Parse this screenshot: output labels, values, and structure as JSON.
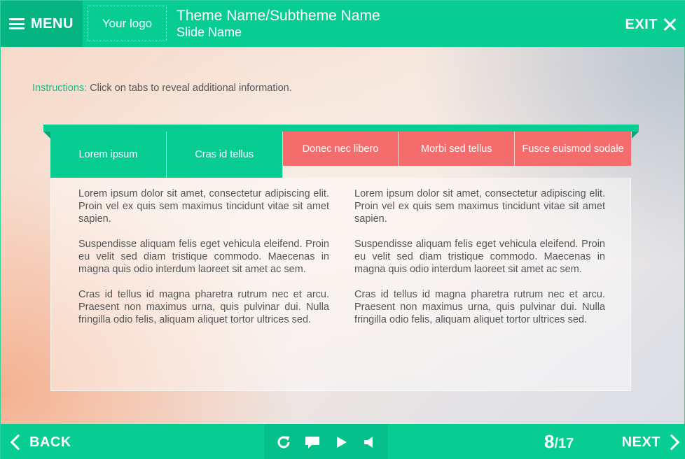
{
  "header": {
    "menu_label": "MENU",
    "logo_text": "Your logo",
    "theme_name": "Theme Name/Subtheme Name",
    "slide_name": "Slide Name",
    "exit_label": "EXIT"
  },
  "instructions": {
    "label": "Instructions:",
    "text": " Click on tabs to reveal additional information."
  },
  "tabs": [
    {
      "label": "Lorem ipsum",
      "state": "active"
    },
    {
      "label": "Cras id tellus",
      "state": "active"
    },
    {
      "label": "Donec nec libero",
      "state": "inactive"
    },
    {
      "label": "Morbi sed tellus",
      "state": "inactive"
    },
    {
      "label": "Fusce euismod sodale",
      "state": "inactive"
    }
  ],
  "content": {
    "left": [
      "Lorem ipsum dolor sit amet, consectetur adipiscing elit. Proin vel ex quis sem maximus tincidunt vitae sit amet sapien.",
      "Suspendisse aliquam felis eget vehicula eleifend. Proin eu velit sed diam tristique commodo. Maecenas in magna quis odio interdum laoreet sit amet ac sem.",
      "Cras id tellus id magna pharetra rutrum nec et arcu. Praesent non maximus urna, quis pulvinar dui. Nulla fringilla odio felis, aliquam aliquet tortor ultrices sed."
    ],
    "right": [
      "Lorem ipsum dolor sit amet, consectetur adipiscing elit. Proin vel ex quis sem maximus tincidunt vitae sit amet sapien.",
      "Suspendisse aliquam felis eget vehicula eleifend. Proin eu velit sed diam tristique commodo. Maecenas in magna quis odio interdum laoreet sit amet ac sem.",
      "Cras id tellus id magna pharetra rutrum nec et arcu. Praesent non maximus urna, quis pulvinar dui. Nulla fringilla odio felis, aliquam aliquet tortor ultrices sed."
    ]
  },
  "footer": {
    "back_label": "BACK",
    "next_label": "NEXT",
    "current_slide": "8",
    "separator": "/",
    "total_slides": "17",
    "controls": [
      "replay-icon",
      "comment-icon",
      "play-icon",
      "volume-icon"
    ]
  },
  "colors": {
    "primary": "#08cd93",
    "primary_dark": "#05b480",
    "tab_inactive": "#f46c6c",
    "text": "#555555",
    "instruction_label": "#1bb889"
  }
}
